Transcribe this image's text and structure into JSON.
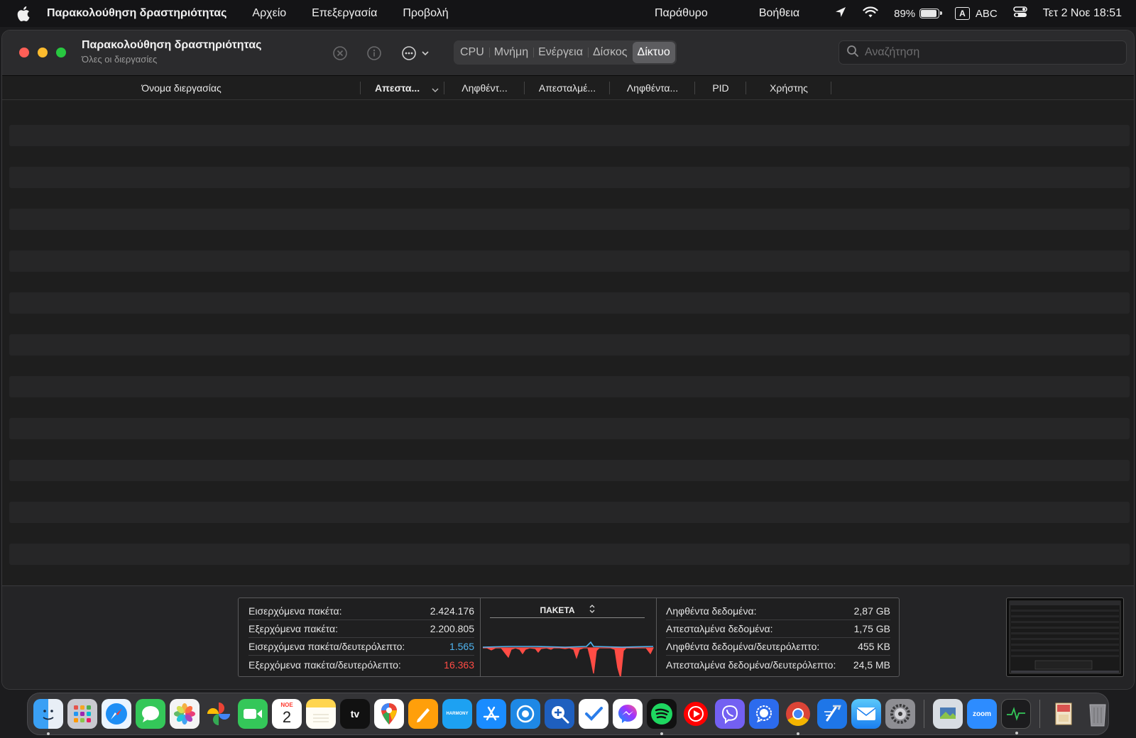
{
  "menubar": {
    "app_name": "Παρακολούθηση δραστηριότητας",
    "items": [
      "Αρχείο",
      "Επεξεργασία",
      "Προβολή",
      "Παράθυρο",
      "Βοήθεια"
    ],
    "battery_pct": "89%",
    "battery_level": 0.89,
    "input_badge": "A",
    "input_source": "ABC",
    "clock": "Τετ 2 Νοε  18:51"
  },
  "window": {
    "title": "Παρακολούθηση δραστηριότητας",
    "subtitle": "Όλες οι διεργασίες",
    "tabs": [
      "CPU",
      "Μνήμη",
      "Ενέργεια",
      "Δίσκος",
      "Δίκτυο"
    ],
    "active_tab": "Δίκτυο",
    "search_placeholder": "Αναζήτηση"
  },
  "table": {
    "columns": [
      "Όνομα διεργασίας",
      "Απεστα...",
      "Ληφθέντ...",
      "Απεσταλμέ...",
      "Ληφθέντα...",
      "PID",
      "Χρήστης"
    ],
    "sorted_column": "Απεστα...",
    "row_count": 11
  },
  "stats": {
    "left": [
      {
        "label": "Εισερχόμενα πακέτα:",
        "value": "2.424.176"
      },
      {
        "label": "Εξερχόμενα πακέτα:",
        "value": "2.200.805"
      },
      {
        "label": "Εισερχόμενα πακέτα/δευτερόλεπτο:",
        "value": "1.565"
      },
      {
        "label": "Εξερχόμενα πακέτα/δευτερόλεπτο:",
        "value": "16.363"
      }
    ],
    "graph_title": "ΠΑΚΕΤΑ",
    "right": [
      {
        "label": "Ληφθέντα δεδομένα:",
        "value": "2,87 GB"
      },
      {
        "label": "Απεσταλμένα δεδομένα:",
        "value": "1,75 GB"
      },
      {
        "label": "Ληφθέντα δεδομένα/δευτερόλεπτο:",
        "value": "455 KB"
      },
      {
        "label": "Απεσταλμένα δεδομένα/δευτερόλεπτο:",
        "value": "24,5 MB"
      }
    ],
    "colors": {
      "in": "#4fb4f0",
      "out": "#ff4c45"
    }
  },
  "dock": {
    "apps": [
      "finder",
      "launchpad",
      "safari",
      "messages",
      "photos",
      "google-photos",
      "facetime",
      "calendar",
      "notes",
      "apple-tv",
      "google-maps",
      "pages",
      "harmony",
      "app-store",
      "app-a",
      "proxyman",
      "tasks",
      "messenger",
      "spotify",
      "youtube",
      "viber",
      "signal",
      "chrome",
      "xcode",
      "mail",
      "system-settings",
      "preview",
      "zoom",
      "activity-monitor",
      "archive",
      "trash"
    ],
    "calendar_month": "ΝΟΕ",
    "calendar_day": "2",
    "tv_label": "tv",
    "harmony_label": "HARMONY",
    "zoom_label": "zoom"
  }
}
